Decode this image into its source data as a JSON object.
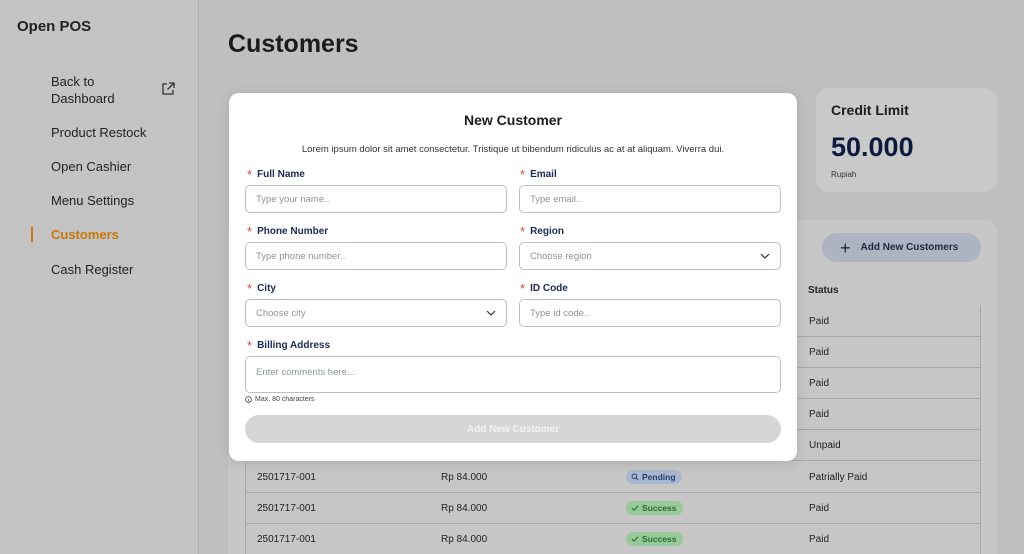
{
  "app": {
    "title": "Open POS"
  },
  "sidebar": {
    "items": [
      {
        "label": "Back to Dashboard",
        "active": false
      },
      {
        "label": "Product Restock",
        "active": false
      },
      {
        "label": "Open Cashier",
        "active": false
      },
      {
        "label": "Menu Settings",
        "active": false
      },
      {
        "label": "Customers",
        "active": true
      },
      {
        "label": "Cash Register",
        "active": false
      }
    ],
    "back_line1": "Back to",
    "back_line2": "Dashboard"
  },
  "page": {
    "title": "Customers"
  },
  "stat": {
    "label": "Credit Limit",
    "value": "50.000",
    "unit": "Rupiah"
  },
  "table": {
    "add_button": "Add New Customers",
    "status_header": "Status",
    "rows_hidden": [
      {
        "status": "Paid"
      },
      {
        "status": "Paid"
      },
      {
        "status": "Paid"
      },
      {
        "status": "Paid"
      },
      {
        "status": "Unpaid"
      }
    ],
    "rows_visible": [
      {
        "id": "2501717-001",
        "amount": "Rp 84.000",
        "badge": "Pending",
        "badge_type": "pending",
        "status": "Patrially Paid"
      },
      {
        "id": "2501717-001",
        "amount": "Rp 84.000",
        "badge": "Success",
        "badge_type": "success",
        "status": "Paid"
      },
      {
        "id": "2501717-001",
        "amount": "Rp 84.000",
        "badge": "Success",
        "badge_type": "success",
        "status": "Paid"
      }
    ]
  },
  "modal": {
    "title": "New Customer",
    "description": "Lorem ipsum dolor sit amet consectetur. Tristique ut bibendum ridiculus ac at at aliquam. Viverra dui.",
    "fields": {
      "full_name": {
        "label": "Full Name",
        "placeholder": "Type your name.."
      },
      "email": {
        "label": "Email",
        "placeholder": "Type email.."
      },
      "phone": {
        "label": "Phone Number",
        "placeholder": "Type phone number.."
      },
      "region": {
        "label": "Region",
        "placeholder": "Choose region"
      },
      "city": {
        "label": "City",
        "placeholder": "Choose city"
      },
      "id_code": {
        "label": "ID Code",
        "placeholder": "Type id code.."
      },
      "billing": {
        "label": "Billing Address",
        "placeholder": "Enter comments here...",
        "hint": "Max. 80 characters"
      }
    },
    "submit": "Add New Customer"
  },
  "colors": {
    "accent": "#c7780a",
    "navy": "#0f1a3b",
    "required": "#e0443a"
  }
}
